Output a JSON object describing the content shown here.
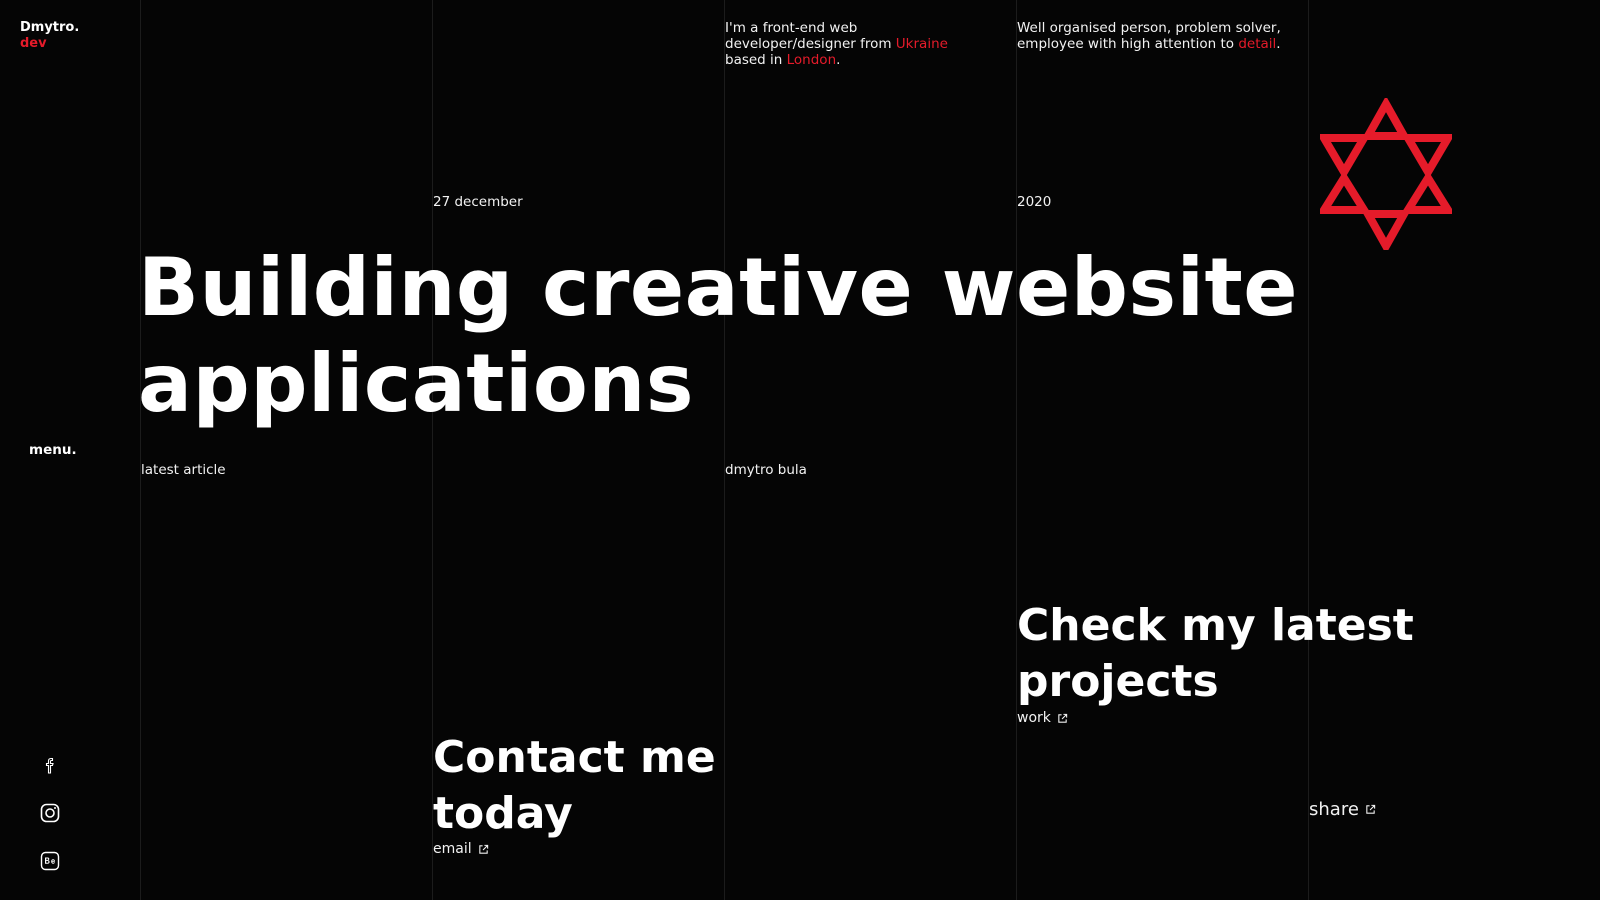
{
  "logo": {
    "line1": "Dmytro.",
    "line2": "dev"
  },
  "intro": {
    "part1": "I'm a front-end web developer/designer from ",
    "country": "Ukraine",
    "part2": " based in ",
    "city": "London",
    "part3": "."
  },
  "about": {
    "part1": "Well organised person, problem solver, employee with high attention to ",
    "highlight": "detail",
    "part2": "."
  },
  "date_label": "27 december",
  "year_label": "2020",
  "headline": {
    "line1": "Building creative website",
    "line2": "applications"
  },
  "menu_label": "menu.",
  "latest_article_label": "latest article",
  "author_label": "dmytro bula",
  "projects": {
    "line1": "Check my latest",
    "line2": "projects",
    "link": "work"
  },
  "contact": {
    "line1": "Contact me",
    "line2": "today",
    "link": "email"
  },
  "share_label": "share",
  "social": [
    "facebook-icon",
    "instagram-icon",
    "behance-icon"
  ],
  "colors": {
    "accent": "#e51b2a",
    "background": "#050505",
    "text": "#ffffff"
  }
}
